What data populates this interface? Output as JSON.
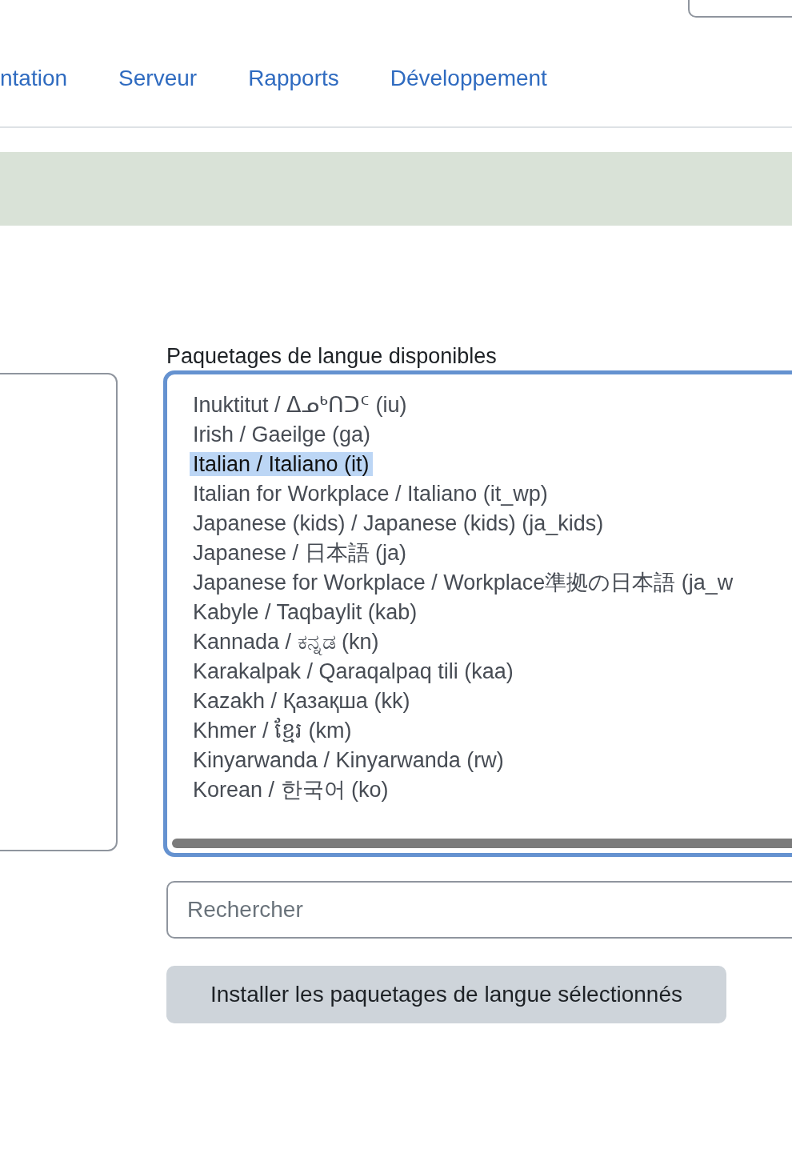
{
  "nav": {
    "links": [
      "ntation",
      "Serveur",
      "Rapports",
      "Développement"
    ]
  },
  "available_packs": {
    "label": "Paquetages de langue disponibles",
    "items": [
      {
        "label": "Inuktitut / ᐃᓄᒃᑎᑐᑦ (iu)",
        "selected": false
      },
      {
        "label": "Irish / Gaeilge (ga)",
        "selected": false
      },
      {
        "label": "Italian / Italiano (it)",
        "selected": true
      },
      {
        "label": "Italian for Workplace / Italiano (it_wp)",
        "selected": false
      },
      {
        "label": "Japanese (kids) / Japanese (kids) (ja_kids)",
        "selected": false
      },
      {
        "label": "Japanese / 日本語 (ja)",
        "selected": false
      },
      {
        "label": "Japanese for Workplace / Workplace準拠の日本語 (ja_w",
        "selected": false
      },
      {
        "label": "Kabyle / Taqbaylit (kab)",
        "selected": false
      },
      {
        "label": "Kannada / ಕನ್ನಡ (kn)",
        "selected": false
      },
      {
        "label": "Karakalpak / Qaraqalpaq tili (kaa)",
        "selected": false
      },
      {
        "label": "Kazakh / Қазақша (kk)",
        "selected": false
      },
      {
        "label": "Khmer / ខ្មែរ (km)",
        "selected": false
      },
      {
        "label": "Kinyarwanda / Kinyarwanda (rw)",
        "selected": false
      },
      {
        "label": "Korean / 한국어 (ko)",
        "selected": false
      }
    ],
    "search": {
      "placeholder": "Rechercher"
    },
    "install_button": "Installer les paquetages de langue sélectionnés"
  }
}
